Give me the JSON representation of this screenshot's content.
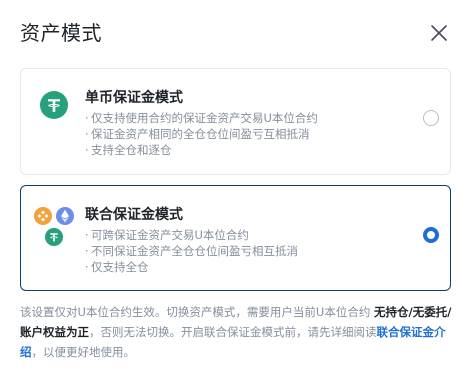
{
  "dialog": {
    "title": "资产模式"
  },
  "modes": {
    "single": {
      "title": "单币保证金模式",
      "bullets": [
        "仅支持使用合约的保证金资产交易U本位合约",
        "保证金资产相同的全仓仓位间盈亏互相抵消",
        "支持全仓和逐仓"
      ],
      "selected": false
    },
    "multi": {
      "title": "联合保证金模式",
      "bullets": [
        "可跨保证金资产交易U本位合约",
        "不同保证金资产全仓仓位间盈亏相互抵消",
        "仅支持全仓"
      ],
      "selected": true
    }
  },
  "note": {
    "part1": "该设置仅对U本位合约生效。切换资产模式，需要用户当前U本位合约 ",
    "strong": "无持仓/无委托/账户权益为正",
    "part2": "，否则无法切换。开启联合保证金模式前，请先详细阅读",
    "link": "联合保证金介绍",
    "part3": "，以便更好地使用。"
  },
  "colors": {
    "tether": "#26a17b",
    "bnb_orange": "#f0a33a",
    "eth_blue": "#6c8fe6",
    "accent_blue": "#1f6fd1",
    "selected_border": "#0b3f67"
  }
}
